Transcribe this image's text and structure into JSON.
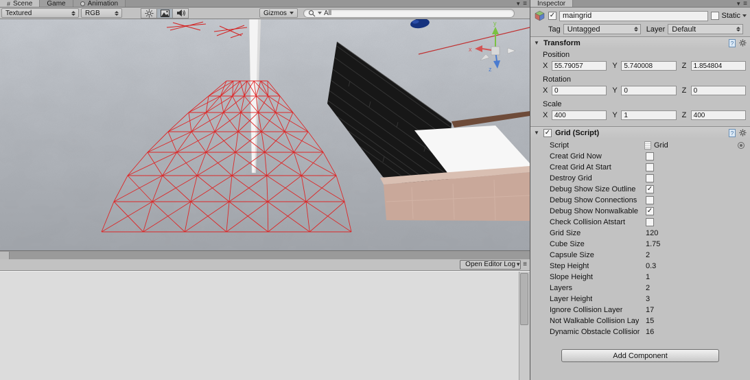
{
  "colors": {
    "selection_wireframe": "#e02020",
    "axis_x": "#d35454",
    "axis_y": "#7ac143",
    "axis_z": "#4a7bd0"
  },
  "scene_panel": {
    "tabs": [
      {
        "label": "Scene"
      },
      {
        "label": "Game"
      },
      {
        "label": "Animation"
      }
    ],
    "toolbar": {
      "draw_mode": "Textured",
      "render_mode": "RGB",
      "gizmos_label": "Gizmos",
      "search_value": "All"
    },
    "gizmo": {
      "x_label": "x",
      "y_label": "y",
      "z_label": "z"
    }
  },
  "console_panel": {
    "open_editor_log_label": "Open Editor Log"
  },
  "inspector": {
    "tab_label": "Inspector",
    "header": {
      "active_checked": true,
      "name_value": "maingrid",
      "static_label": "Static",
      "static_checked": false,
      "tag_label": "Tag",
      "tag_value": "Untagged",
      "layer_label": "Layer",
      "layer_value": "Default"
    },
    "transform": {
      "title": "Transform",
      "position_label": "Position",
      "rotation_label": "Rotation",
      "scale_label": "Scale",
      "x_label": "X",
      "y_label": "Y",
      "z_label": "Z",
      "position": {
        "x": "55.79057",
        "y": "5.740008",
        "z": "1.854804"
      },
      "rotation": {
        "x": "0",
        "y": "0",
        "z": "0"
      },
      "scale": {
        "x": "400",
        "y": "1",
        "z": "400"
      }
    },
    "grid_script": {
      "title": "Grid (Script)",
      "enabled": true,
      "rows": [
        {
          "label": "Script",
          "type": "object",
          "value": "Grid"
        },
        {
          "label": "Creat Grid Now",
          "type": "checkbox",
          "checked": false
        },
        {
          "label": "Creat Grid At Start",
          "type": "checkbox",
          "checked": false
        },
        {
          "label": "Destroy Grid",
          "type": "checkbox",
          "checked": false
        },
        {
          "label": "Debug Show Size Outline",
          "type": "checkbox",
          "checked": true
        },
        {
          "label": "Debug Show Connections",
          "type": "checkbox",
          "checked": false
        },
        {
          "label": "Debug Show Nonwalkable",
          "type": "checkbox",
          "checked": true
        },
        {
          "label": "Check Collision Atstart",
          "type": "checkbox",
          "checked": false
        },
        {
          "label": "Grid Size",
          "type": "value",
          "value": "120"
        },
        {
          "label": "Cube Size",
          "type": "value",
          "value": "1.75"
        },
        {
          "label": "Capsule Size",
          "type": "value",
          "value": "2"
        },
        {
          "label": "Step Height",
          "type": "value",
          "value": "0.3"
        },
        {
          "label": "Slope Height",
          "type": "value",
          "value": "1"
        },
        {
          "label": "Layers",
          "type": "value",
          "value": "2"
        },
        {
          "label": "Layer Height",
          "type": "value",
          "value": "3"
        },
        {
          "label": "Ignore Collision Layer",
          "type": "value",
          "value": "17"
        },
        {
          "label": "Not Walkable Collision Lay",
          "type": "value",
          "value": "15"
        },
        {
          "label": "Dynamic Obstacle Collisior",
          "type": "value",
          "value": "16"
        }
      ]
    },
    "add_component_label": "Add Component"
  }
}
